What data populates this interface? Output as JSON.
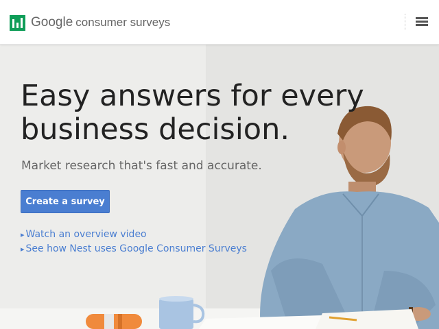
{
  "header": {
    "logo_google": "Google",
    "logo_product": "consumer surveys",
    "menu_icon": "hamburger-menu-icon",
    "logo_icon": "bar-chart-logo-icon",
    "logo_colors": {
      "green": "#0f9d58",
      "white": "#ffffff"
    }
  },
  "hero": {
    "headline": "Easy answers for every business decision.",
    "subhead": "Market research that's fast and accurate.",
    "cta_label": "Create a survey",
    "links": [
      {
        "arrow": "▸",
        "label": "Watch an overview video"
      },
      {
        "arrow": "▸",
        "label": "See how Nest uses Google Consumer Surveys"
      }
    ]
  },
  "colors": {
    "accent": "#4a7ed1",
    "headline": "#222222",
    "subhead": "#666666"
  }
}
